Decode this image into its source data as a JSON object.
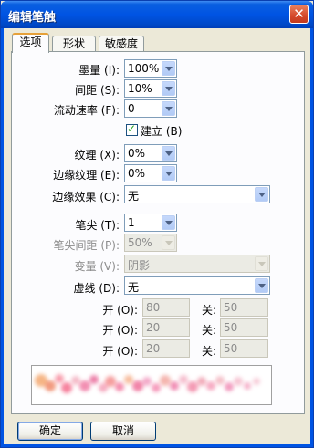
{
  "window": {
    "title": "编辑笔触",
    "close_glyph": "✕"
  },
  "tabs": [
    {
      "label": "选项"
    },
    {
      "label": "形状"
    },
    {
      "label": "敏感度"
    }
  ],
  "fields": {
    "ink": {
      "label": "墨量 (I):",
      "value": "100%"
    },
    "spacing": {
      "label": "间距 (S):",
      "value": "10%"
    },
    "flow": {
      "label": "流动速率 (F):",
      "value": "0"
    },
    "build_up": {
      "label": "建立 (B)",
      "checked": true
    },
    "texture": {
      "label": "纹理 (X):",
      "value": "0%"
    },
    "edge_texture": {
      "label": "边缘纹理 (E):",
      "value": "0%"
    },
    "edge_effect": {
      "label": "边缘效果 (C):",
      "value": "无"
    },
    "tips": {
      "label": "笔尖 (T):",
      "value": "1"
    },
    "tip_spacing": {
      "label": "笔尖间距 (P):",
      "value": "50%"
    },
    "variation": {
      "label": "变量 (V):",
      "value": "阴影"
    },
    "dash": {
      "label": "虚线 (D):",
      "value": "无"
    }
  },
  "dash_rows": [
    {
      "on_label": "开 (O):",
      "on_value": "80",
      "off_label": "关:",
      "off_value": "50"
    },
    {
      "on_label": "开 (O):",
      "on_value": "20",
      "off_label": "关:",
      "off_value": "50"
    },
    {
      "on_label": "开 (O):",
      "on_value": "20",
      "off_label": "关:",
      "off_value": "50"
    }
  ],
  "buttons": {
    "ok": "确定",
    "cancel": "取消"
  },
  "colors": {
    "title_bar": "#0054e3",
    "accent_tab": "#e6a13a",
    "check": "#21a121"
  }
}
